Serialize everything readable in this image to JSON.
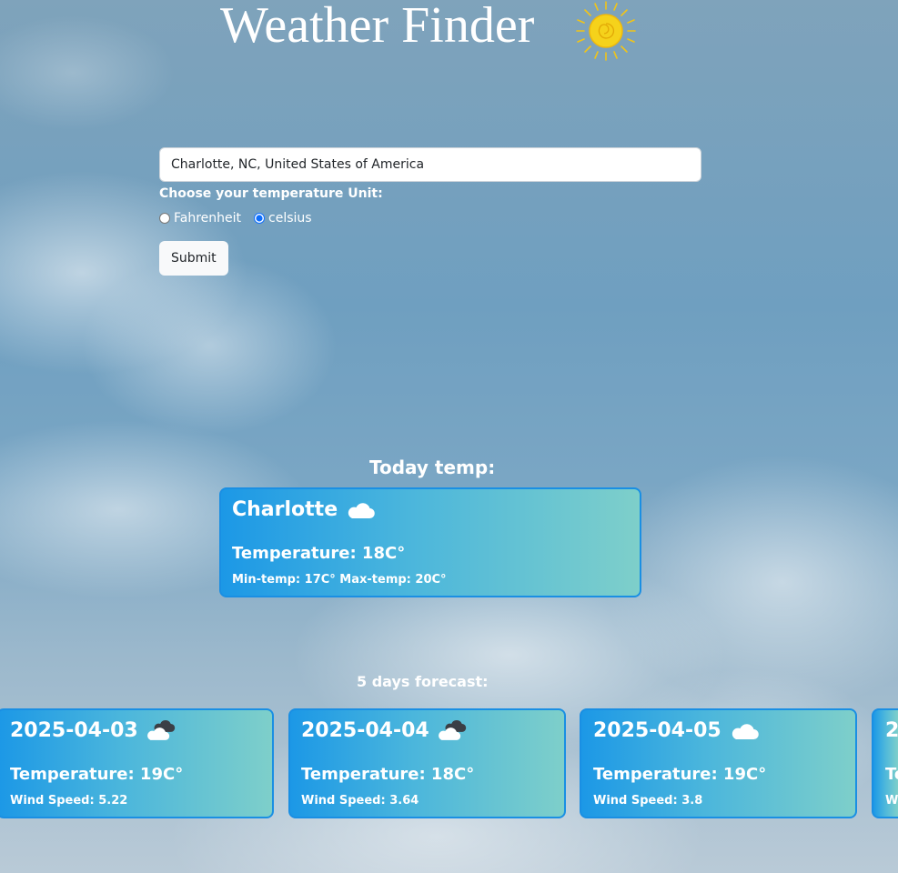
{
  "header": {
    "title": "Weather Finder",
    "icon": "sun-icon"
  },
  "form": {
    "city_value": "Charlotte, NC, United States of America",
    "unit_label": "Choose your temperature Unit:",
    "unit_options": [
      "Fahrenheit",
      "celsius"
    ],
    "selected_unit": "celsius",
    "submit_label": "Submit"
  },
  "today": {
    "section_title": "Today temp:",
    "city": "Charlotte",
    "icon": "cloud-icon",
    "temperature": "Temperature: 18C°",
    "minmax": "Min-temp: 17C° Max-temp: 20C°"
  },
  "forecast": {
    "section_title": "5 days forecast:",
    "days": [
      {
        "date": "2025-04-03",
        "icon": "cloudy-icon",
        "temperature": "Temperature: 19C°",
        "wind": "Wind Speed: 5.22"
      },
      {
        "date": "2025-04-04",
        "icon": "cloudy-icon",
        "temperature": "Temperature: 18C°",
        "wind": "Wind Speed: 3.64"
      },
      {
        "date": "2025-04-05",
        "icon": "cloud-icon",
        "temperature": "Temperature: 19C°",
        "wind": "Wind Speed: 3.8"
      },
      {
        "date": "2",
        "icon": "",
        "temperature": "Te",
        "wind": "W"
      }
    ]
  },
  "colors": {
    "card_gradient_start": "#1c98e6",
    "card_gradient_end": "#7ecfca",
    "card_border": "#1a8fe3",
    "sun_yellow": "#f5d21b"
  }
}
